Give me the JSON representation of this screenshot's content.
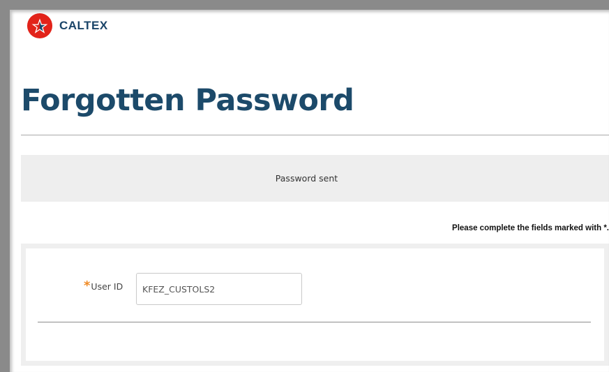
{
  "brand": {
    "name": "CALTEX",
    "icon": "caltex-star-logo",
    "colors": {
      "red": "#e2231a",
      "navy": "#1a4468"
    }
  },
  "page": {
    "title": "Forgotten Password",
    "title_color": "#1c4a6a"
  },
  "status": {
    "message": "Password sent"
  },
  "form": {
    "required_note": "Please complete the fields marked with *.",
    "fields": [
      {
        "label": "User ID",
        "required": true,
        "required_marker": "*",
        "value": "KFEZ_CUSTOLS2"
      }
    ]
  },
  "colors": {
    "required_star": "#f08a24",
    "banner_bg": "#eeeeee"
  }
}
